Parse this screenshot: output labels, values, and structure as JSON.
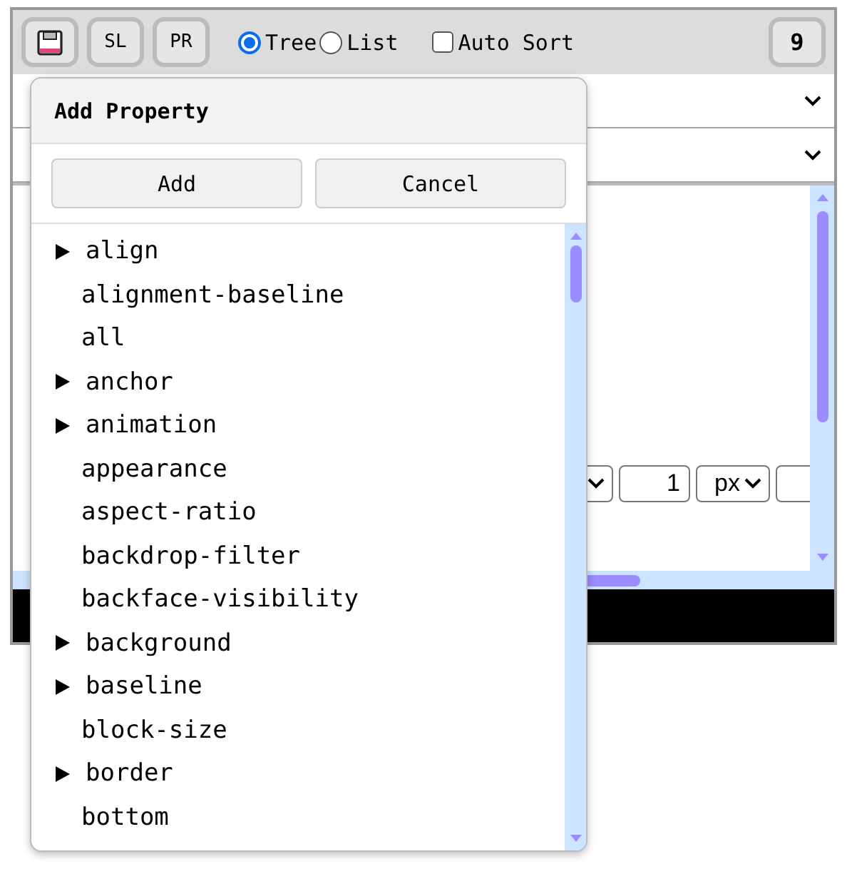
{
  "toolbar": {
    "buttons": [
      {
        "kind": "save"
      },
      {
        "kind": "text",
        "label": "SL"
      },
      {
        "kind": "text",
        "label": "PR"
      }
    ],
    "view_options": [
      {
        "label": "Tree",
        "selected": true
      },
      {
        "label": "List",
        "selected": false
      }
    ],
    "auto_sort": {
      "label": "Auto Sort",
      "checked": false
    },
    "count_button": "9"
  },
  "value_row": {
    "number": "1",
    "unit": "px"
  },
  "popup": {
    "title": "Add Property",
    "buttons": [
      "Add",
      "Cancel"
    ],
    "properties": [
      {
        "name": "align",
        "expandable": true
      },
      {
        "name": "alignment-baseline",
        "expandable": false
      },
      {
        "name": "all",
        "expandable": false
      },
      {
        "name": "anchor",
        "expandable": true
      },
      {
        "name": "animation",
        "expandable": true
      },
      {
        "name": "appearance",
        "expandable": false
      },
      {
        "name": "aspect-ratio",
        "expandable": false
      },
      {
        "name": "backdrop-filter",
        "expandable": false
      },
      {
        "name": "backface-visibility",
        "expandable": false
      },
      {
        "name": "background",
        "expandable": true
      },
      {
        "name": "baseline",
        "expandable": true
      },
      {
        "name": "block-size",
        "expandable": false
      },
      {
        "name": "border",
        "expandable": true
      },
      {
        "name": "bottom",
        "expandable": false
      }
    ]
  }
}
